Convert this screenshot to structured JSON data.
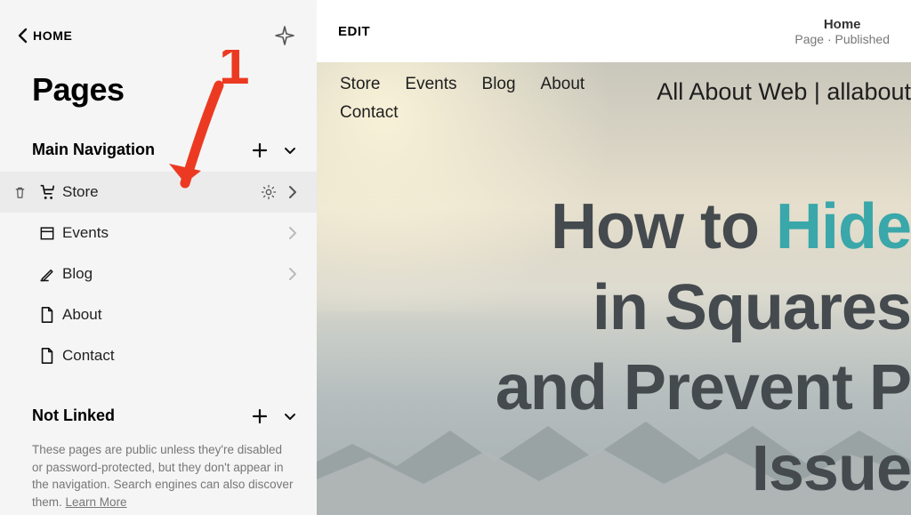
{
  "sidebar": {
    "back_label": "HOME",
    "title": "Pages",
    "sections": {
      "main_nav": {
        "label": "Main Navigation"
      },
      "not_linked": {
        "label": "Not Linked",
        "description": "These pages are public unless they're disabled or password-protected, but they don't appear in the navigation. Search engines can also discover them.",
        "learn_more": "Learn More"
      }
    },
    "items": [
      {
        "label": "Store",
        "icon": "cart-icon",
        "active": true
      },
      {
        "label": "Events",
        "icon": "calendar-icon",
        "active": false
      },
      {
        "label": "Blog",
        "icon": "pencil-icon",
        "active": false
      },
      {
        "label": "About",
        "icon": "page-icon",
        "active": false
      },
      {
        "label": "Contact",
        "icon": "page-icon",
        "active": false
      }
    ]
  },
  "preview": {
    "edit_label": "EDIT",
    "page_name": "Home",
    "page_status": "Page · Published",
    "site_title": "All About Web | allabout",
    "nav_items": [
      "Store",
      "Events",
      "Blog",
      "About",
      "Contact"
    ],
    "hero": {
      "line1_pre": "How to ",
      "line1_accent": "Hide",
      "line2": "in Squares",
      "line3": "and Prevent P",
      "line4": "Issue"
    }
  },
  "annotation": {
    "number": "1"
  },
  "colors": {
    "accent": "#3aa7aa",
    "annotation": "#ec3a22"
  }
}
